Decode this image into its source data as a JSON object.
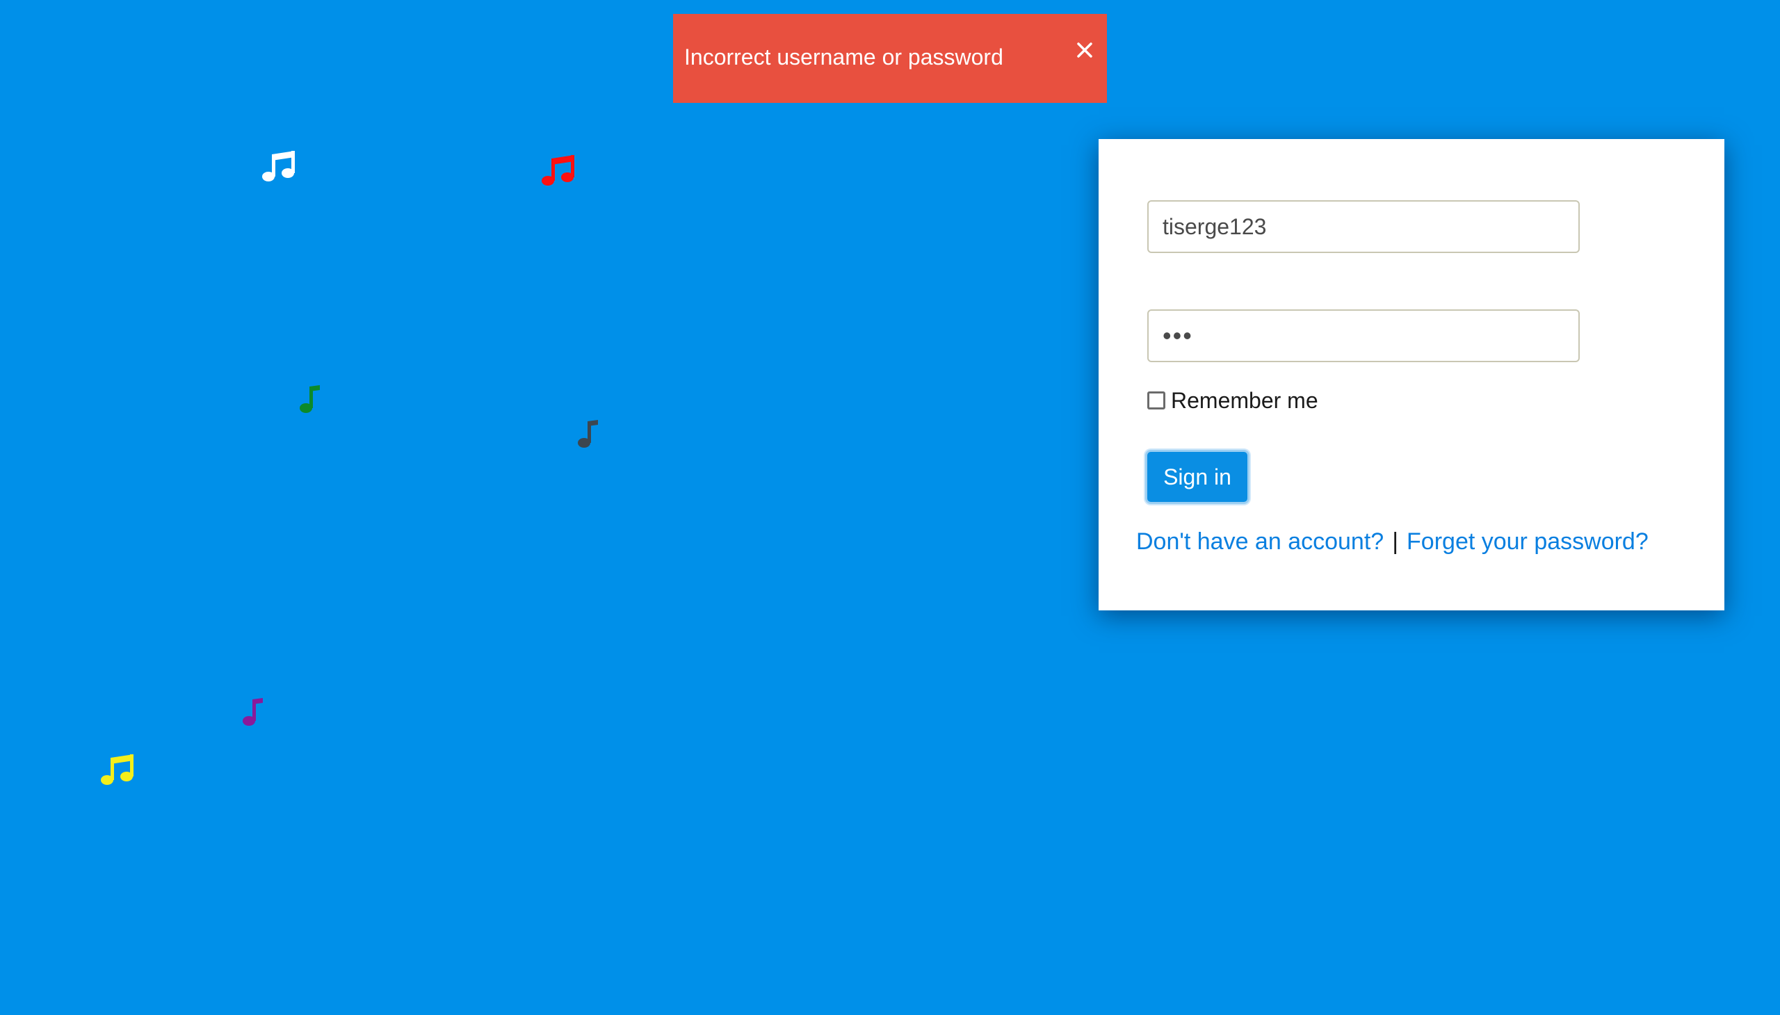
{
  "alert": {
    "message": "Incorrect username or password",
    "close_icon": "close-icon",
    "background": "#e8503f"
  },
  "background_color": "#0090e9",
  "decor": {
    "notes": [
      {
        "icon": "beamed-notes-icon",
        "color": "#ffffff"
      },
      {
        "icon": "beamed-notes-icon",
        "color": "#ff1010"
      },
      {
        "icon": "music-note-icon",
        "color": "#0c8a2a"
      },
      {
        "icon": "music-note-icon",
        "color": "#3c4650"
      },
      {
        "icon": "music-note-icon",
        "color": "#8a1a9a"
      },
      {
        "icon": "beamed-notes-icon",
        "color": "#f4ef1a"
      }
    ]
  },
  "login": {
    "username_value": "tiserge123",
    "password_value": "•••",
    "remember_label": "Remember me",
    "remember_checked": false,
    "signin_label": "Sign in",
    "signup_link": "Don't have an account?",
    "separator": "|",
    "forgot_link": "Forget your password?",
    "accent_color": "#0a8ee3"
  }
}
